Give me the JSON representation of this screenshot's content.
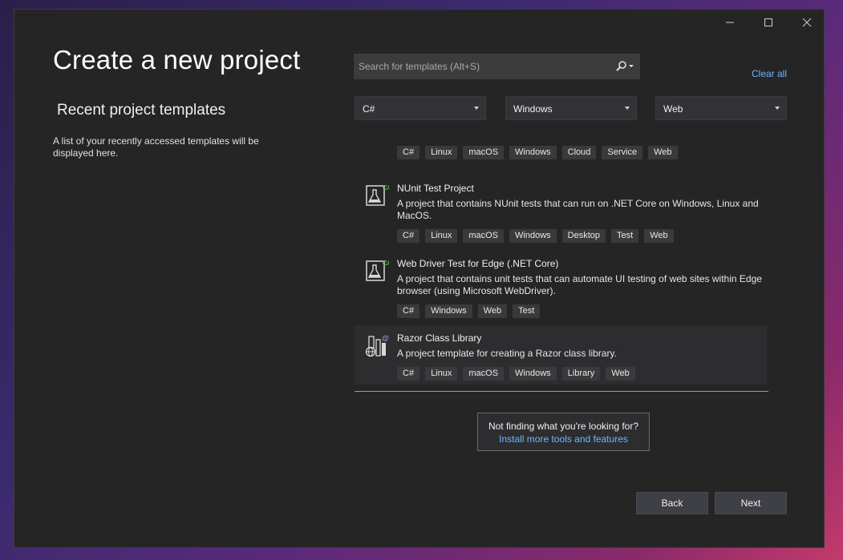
{
  "window": {
    "controls": {
      "minimize": "—",
      "maximize": "☐",
      "close": "✕"
    }
  },
  "page_title": "Create a new project",
  "recent": {
    "title": "Recent project templates",
    "description": "A list of your recently accessed templates will be displayed here."
  },
  "search": {
    "placeholder": "Search for templates (Alt+S)",
    "icon": "search-icon"
  },
  "clear_all": "Clear all",
  "filters": {
    "language": "C#",
    "platform": "Windows",
    "project_type": "Web"
  },
  "templates": [
    {
      "name": "",
      "description": "",
      "tags": [
        "C#",
        "Linux",
        "macOS",
        "Windows",
        "Cloud",
        "Service",
        "Web"
      ]
    },
    {
      "name": "NUnit Test Project",
      "description": "A project that contains NUnit tests that can run on .NET Core on Windows, Linux and MacOS.",
      "badge": "C#",
      "icon": "test-flask-icon",
      "tags": [
        "C#",
        "Linux",
        "macOS",
        "Windows",
        "Desktop",
        "Test",
        "Web"
      ]
    },
    {
      "name": "Web Driver Test for Edge (.NET Core)",
      "description": "A project that contains unit tests that can automate UI testing of web sites within Edge browser (using Microsoft WebDriver).",
      "badge": "C#",
      "icon": "test-flask-icon",
      "tags": [
        "C#",
        "Windows",
        "Web",
        "Test"
      ]
    },
    {
      "name": "Razor Class Library",
      "description": "A project template for creating a Razor class library.",
      "badge": "@",
      "icon": "razor-library-icon",
      "tags": [
        "C#",
        "Linux",
        "macOS",
        "Windows",
        "Library",
        "Web"
      ]
    }
  ],
  "not_found": {
    "question": "Not finding what you're looking for?",
    "link": "Install more tools and features"
  },
  "buttons": {
    "back": "Back",
    "next": "Next"
  },
  "colors": {
    "window_bg": "#252526",
    "accent_link": "#6cb6ff",
    "tag_bg": "#3a3a3d",
    "button_bg": "#3f3f46"
  }
}
